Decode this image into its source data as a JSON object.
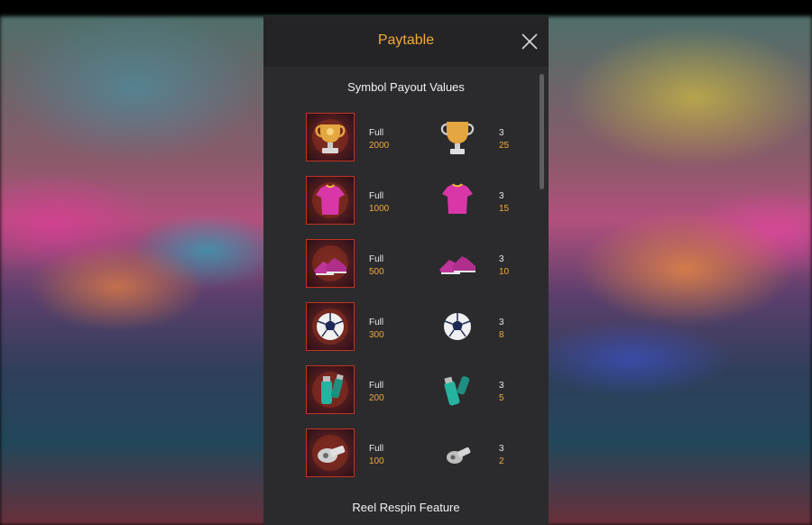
{
  "modal": {
    "title": "Paytable",
    "section_title": "Symbol Payout Values",
    "footer_section_title": "Reel Respin Feature"
  },
  "payouts": [
    {
      "symbol": "trophy-icon",
      "full_label": "Full",
      "full_value": "2000",
      "count_label": "3",
      "count_value": "25"
    },
    {
      "symbol": "jersey-icon",
      "full_label": "Full",
      "full_value": "1000",
      "count_label": "3",
      "count_value": "15"
    },
    {
      "symbol": "boots-icon",
      "full_label": "Full",
      "full_value": "500",
      "count_label": "3",
      "count_value": "10"
    },
    {
      "symbol": "soccer-ball-icon",
      "full_label": "Full",
      "full_value": "300",
      "count_label": "3",
      "count_value": "8"
    },
    {
      "symbol": "spray-can-icon",
      "full_label": "Full",
      "full_value": "200",
      "count_label": "3",
      "count_value": "5"
    },
    {
      "symbol": "whistle-icon",
      "full_label": "Full",
      "full_value": "100",
      "count_label": "3",
      "count_value": "2"
    }
  ],
  "colors": {
    "accent": "#f2a93a",
    "panel": "#2b2b2e",
    "header": "#242427",
    "tile_border": "#c2341f"
  }
}
